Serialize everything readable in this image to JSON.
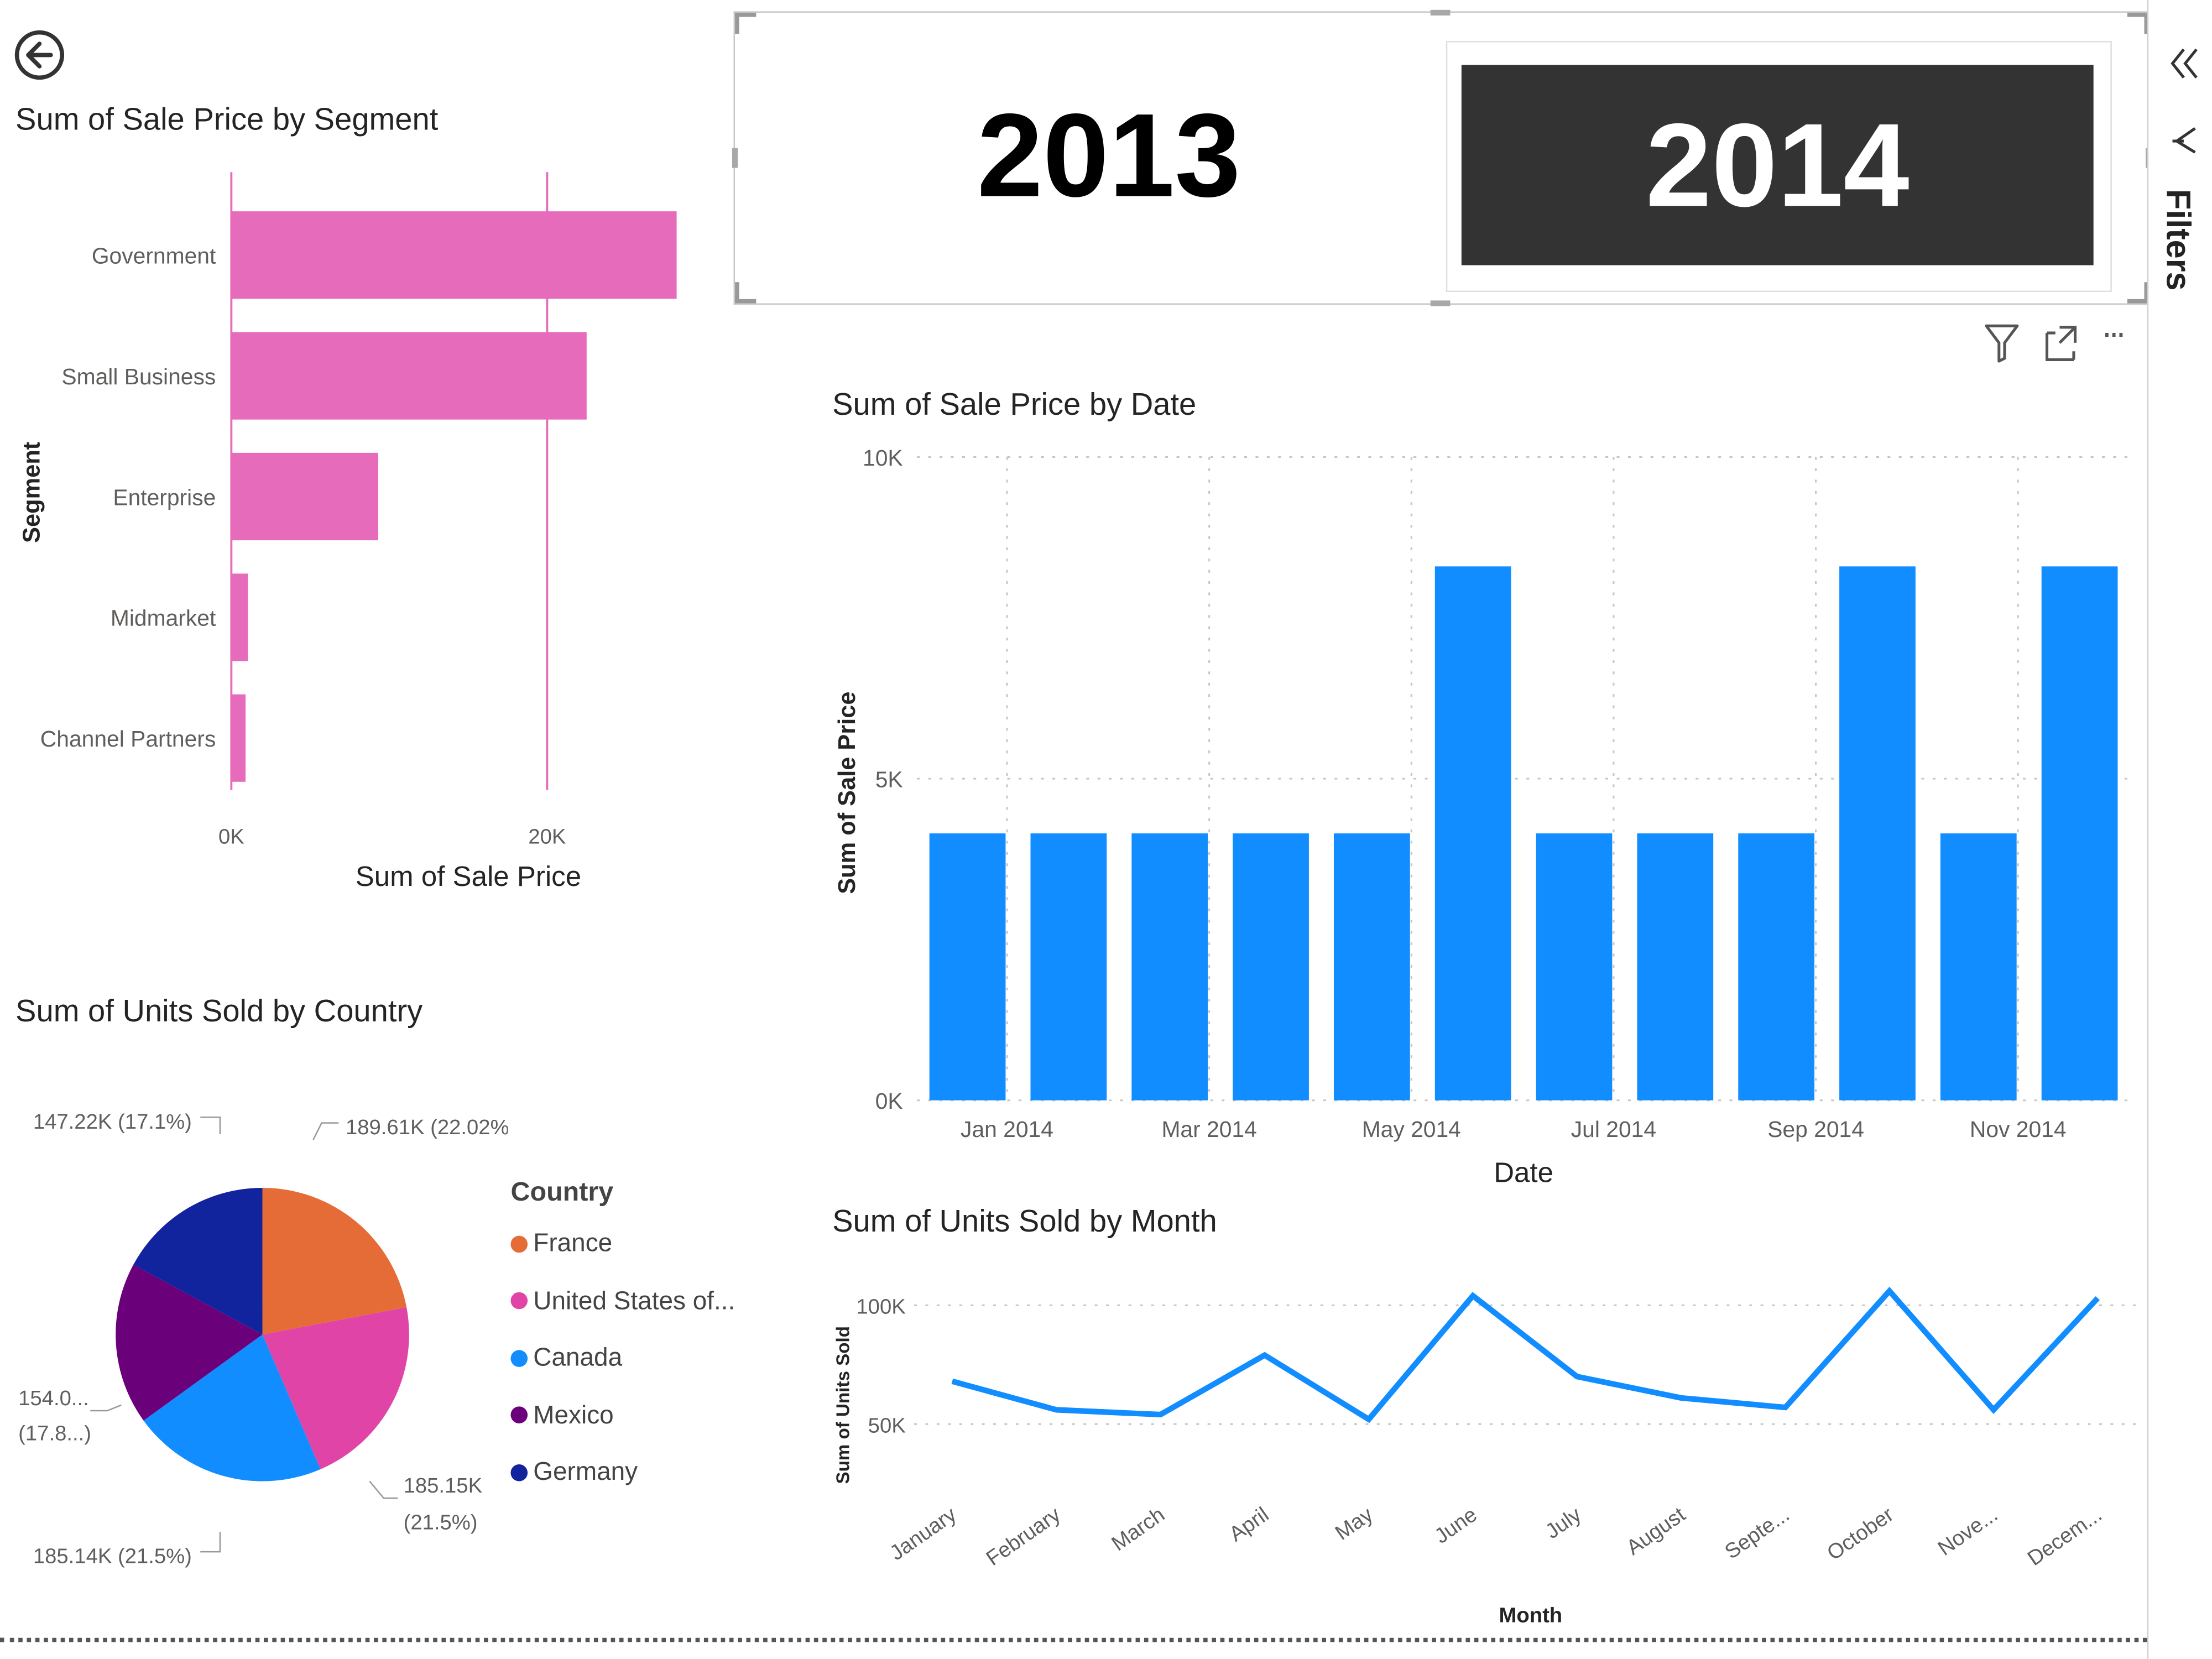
{
  "nav": {
    "back_icon": "back-arrow-icon"
  },
  "slicer": {
    "years": [
      "2013",
      "2014"
    ],
    "selected": "2014"
  },
  "filters_pane": {
    "label": "Filters",
    "collapse_icon": "double-chevron-left-icon",
    "filter_icon": "filter-icon"
  },
  "visual_header": {
    "filter_icon": "filter-icon",
    "focus_icon": "focus-mode-icon",
    "more_icon": "more-options-icon",
    "more_label": "···"
  },
  "segment_chart": {
    "chart_data": {
      "type": "bar",
      "orientation": "horizontal",
      "title": "Sum of Sale Price by Segment",
      "xlabel": "Sum of Sale Price",
      "ylabel": "Segment",
      "categories": [
        "Government",
        "Small Business",
        "Enterprise",
        "Midmarket",
        "Channel Partners"
      ],
      "values": [
        28200,
        22500,
        9300,
        1050,
        900
      ],
      "xlim": [
        0,
        28500
      ],
      "xticks": [
        0,
        20000
      ],
      "xtick_labels": [
        "0K",
        "20K"
      ],
      "color": "#e66bbb"
    }
  },
  "date_chart": {
    "chart_data": {
      "type": "bar",
      "title": "Sum of Sale Price by Date",
      "xlabel": "Date",
      "ylabel": "Sum of Sale Price",
      "categories": [
        "Jan 2014",
        "Feb 2014",
        "Mar 2014",
        "Apr 2014",
        "May 2014",
        "Jun 2014",
        "Jul 2014",
        "Aug 2014",
        "Sep 2014",
        "Oct 2014",
        "Nov 2014",
        "Dec 2014"
      ],
      "tick_labels": [
        "Jan 2014",
        "Mar 2014",
        "May 2014",
        "Jul 2014",
        "Sep 2014",
        "Nov 2014"
      ],
      "values": [
        4150,
        4150,
        4150,
        4150,
        4150,
        8300,
        4150,
        4150,
        4150,
        8300,
        4150,
        8300
      ],
      "ylim": [
        0,
        10000
      ],
      "yticks": [
        0,
        5000,
        10000
      ],
      "ytick_labels": [
        "0K",
        "5K",
        "10K"
      ],
      "grid": true,
      "color": "#118dff"
    }
  },
  "country_chart": {
    "chart_data": {
      "type": "pie",
      "title": "Sum of Units Sold by Country",
      "legend_title": "Country",
      "legend_position": "right",
      "slices": [
        {
          "label": "France",
          "value": 189610,
          "display": "189.61K (22.02%)",
          "color": "#e66c37"
        },
        {
          "label": "United States of...",
          "value": 185150,
          "display": "185.15K (21.5%)",
          "color": "#e044a7"
        },
        {
          "label": "Canada",
          "value": 185140,
          "display": "185.14K (21.5%)",
          "color": "#118dff"
        },
        {
          "label": "Mexico",
          "value": 154000,
          "display": "154.0... (17.8...)",
          "color": "#6b007b"
        },
        {
          "label": "Germany",
          "value": 147220,
          "display": "147.22K (17.1%)",
          "color": "#12239e"
        }
      ],
      "callouts": {
        "france": "189.61K (22.02%)",
        "usa_1": "185.15K",
        "usa_2": "(21.5%)",
        "canada": "185.14K (21.5%)",
        "mexico_1": "154.0...",
        "mexico_2": "(17.8...)",
        "germany": "147.22K (17.1%)"
      }
    }
  },
  "month_chart": {
    "chart_data": {
      "type": "line",
      "title": "Sum of Units Sold by Month",
      "xlabel": "Month",
      "ylabel": "Sum of Units Sold",
      "categories": [
        "January",
        "February",
        "March",
        "April",
        "May",
        "June",
        "July",
        "August",
        "September",
        "October",
        "November",
        "December"
      ],
      "tick_labels": [
        "January",
        "February",
        "March",
        "April",
        "May",
        "June",
        "July",
        "August",
        "Septe...",
        "October",
        "Nove...",
        "Decem..."
      ],
      "values": [
        68000,
        56000,
        54000,
        79000,
        52000,
        104000,
        70000,
        61000,
        57000,
        106000,
        56000,
        103000
      ],
      "ylim": [
        20000,
        115000
      ],
      "yticks": [
        50000,
        100000
      ],
      "ytick_labels": [
        "50K",
        "100K"
      ],
      "grid": true,
      "color": "#118dff"
    }
  }
}
